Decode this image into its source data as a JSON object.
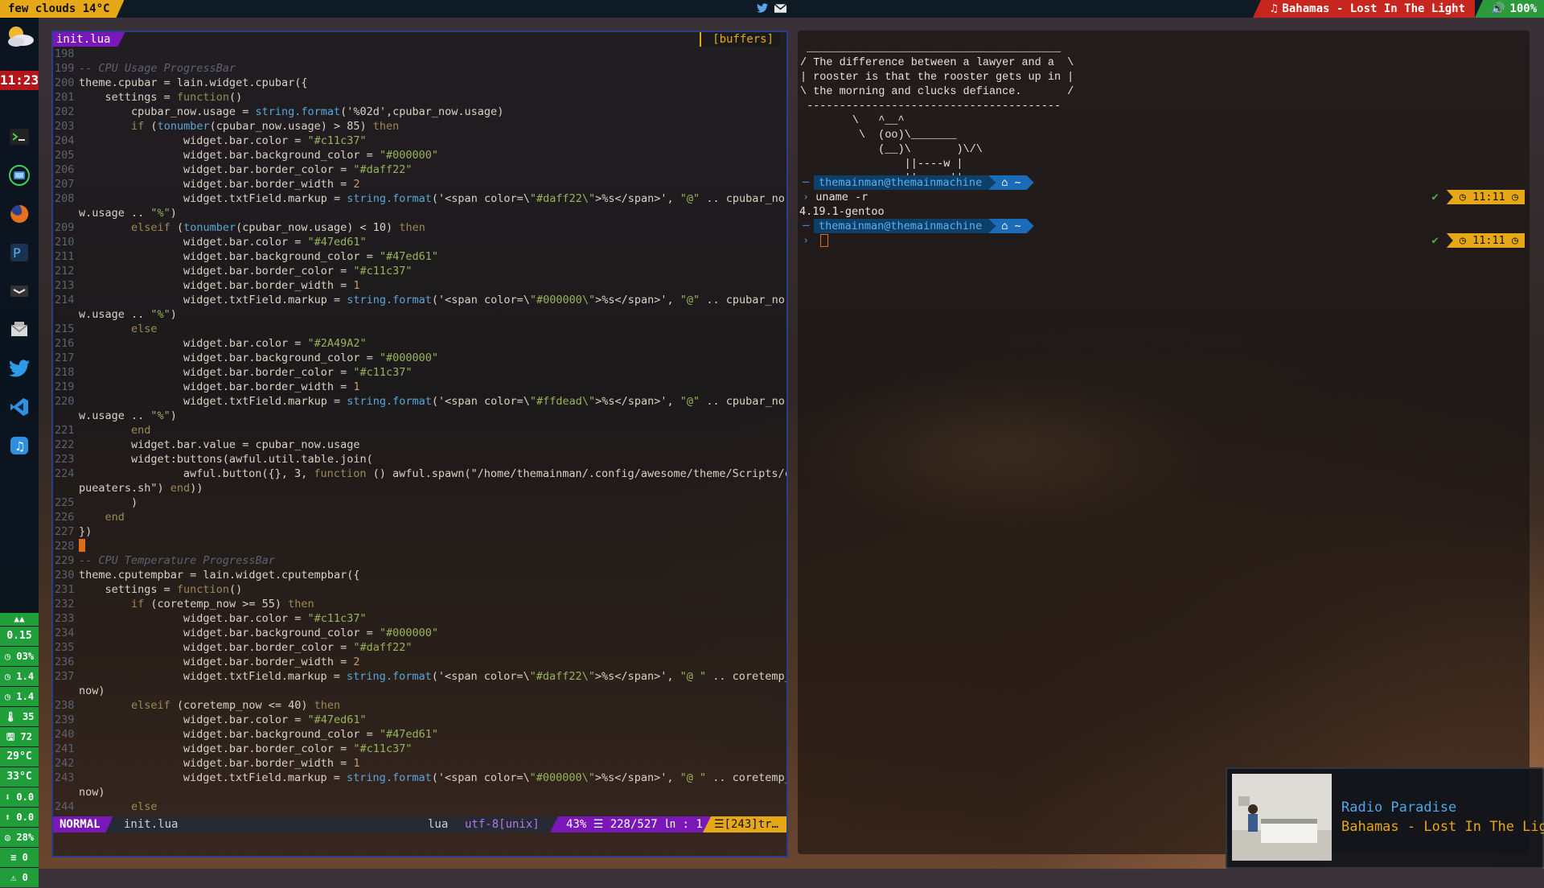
{
  "topbar": {
    "weather": "few clouds 14°C",
    "tray_icons": [
      "twitter-icon",
      "mail-icon"
    ],
    "now_playing": "Bahamas - Lost In The Light",
    "volume": "100%"
  },
  "dock": {
    "clock": "11:23",
    "apps": [
      "terminal-icon",
      "file-manager-icon",
      "firefox-icon",
      "photo-editor-icon",
      "terminal-app-icon",
      "mail-client-icon",
      "twitter-client-icon",
      "vscode-icon",
      "music-player-icon"
    ],
    "stats": [
      "0.15",
      "03%",
      "1.4",
      "1.4",
      "35",
      "72",
      "29°C",
      "33°C",
      "0.0",
      "0.0",
      "28%",
      "0",
      "0"
    ]
  },
  "vim": {
    "tab": "init.lua",
    "buffers_label": "[buffers]",
    "lines": [
      {
        "n": "198",
        "t": ""
      },
      {
        "n": "199",
        "t": "-- CPU Usage ProgressBar"
      },
      {
        "n": "200",
        "t": "theme.cpubar = lain.widget.cpubar({"
      },
      {
        "n": "201",
        "t": "    settings = function()"
      },
      {
        "n": "202",
        "t": "        cpubar_now.usage = string.format('%02d',cpubar_now.usage)"
      },
      {
        "n": "203",
        "t": "        if (tonumber(cpubar_now.usage) > 85) then"
      },
      {
        "n": "204",
        "t": "                widget.bar.color = \"#c11c37\""
      },
      {
        "n": "205",
        "t": "                widget.bar.background_color = \"#000000\""
      },
      {
        "n": "206",
        "t": "                widget.bar.border_color = \"#daff22\""
      },
      {
        "n": "207",
        "t": "                widget.bar.border_width = 2"
      },
      {
        "n": "208",
        "t": "                widget.txtField.markup = string.format('<span color=\\\"#daff22\\\">%s</span>', \"@\" .. cpubar_no"
      },
      {
        "n": "",
        "t": "w.usage .. \"%\")"
      },
      {
        "n": "209",
        "t": "        elseif (tonumber(cpubar_now.usage) < 10) then"
      },
      {
        "n": "210",
        "t": "                widget.bar.color = \"#47ed61\""
      },
      {
        "n": "211",
        "t": "                widget.bar.background_color = \"#47ed61\""
      },
      {
        "n": "212",
        "t": "                widget.bar.border_color = \"#c11c37\""
      },
      {
        "n": "213",
        "t": "                widget.bar.border_width = 1"
      },
      {
        "n": "214",
        "t": "                widget.txtField.markup = string.format('<span color=\\\"#000000\\\">%s</span>', \"@\" .. cpubar_no"
      },
      {
        "n": "",
        "t": "w.usage .. \"%\")"
      },
      {
        "n": "215",
        "t": "        else"
      },
      {
        "n": "216",
        "t": "                widget.bar.color = \"#2A49A2\""
      },
      {
        "n": "217",
        "t": "                widget.bar.background_color = \"#000000\""
      },
      {
        "n": "218",
        "t": "                widget.bar.border_color = \"#c11c37\""
      },
      {
        "n": "219",
        "t": "                widget.bar.border_width = 1"
      },
      {
        "n": "220",
        "t": "                widget.txtField.markup = string.format('<span color=\\\"#ffdead\\\">%s</span>', \"@\" .. cpubar_no"
      },
      {
        "n": "",
        "t": "w.usage .. \"%\")"
      },
      {
        "n": "221",
        "t": "        end"
      },
      {
        "n": "222",
        "t": "        widget.bar.value = cpubar_now.usage"
      },
      {
        "n": "223",
        "t": "        widget:buttons(awful.util.table.join("
      },
      {
        "n": "224",
        "t": "                awful.button({}, 3, function () awful.spawn(\"/home/themainman/.config/awesome/theme/Scripts/c"
      },
      {
        "n": "",
        "t": "pueaters.sh\") end))"
      },
      {
        "n": "225",
        "t": "        )"
      },
      {
        "n": "226",
        "t": "    end"
      },
      {
        "n": "227",
        "t": "})"
      },
      {
        "n": "228",
        "t": ""
      },
      {
        "n": "229",
        "t": "-- CPU Temperature ProgressBar"
      },
      {
        "n": "230",
        "t": "theme.cputempbar = lain.widget.cputempbar({"
      },
      {
        "n": "231",
        "t": "    settings = function()"
      },
      {
        "n": "232",
        "t": "        if (coretemp_now >= 55) then"
      },
      {
        "n": "233",
        "t": "                widget.bar.color = \"#c11c37\""
      },
      {
        "n": "234",
        "t": "                widget.bar.background_color = \"#000000\""
      },
      {
        "n": "235",
        "t": "                widget.bar.border_color = \"#daff22\""
      },
      {
        "n": "236",
        "t": "                widget.bar.border_width = 2"
      },
      {
        "n": "237",
        "t": "                widget.txtField.markup = string.format('<span color=\\\"#daff22\\\">%s</span>', \"@ \" .. coretemp_"
      },
      {
        "n": "",
        "t": "now)"
      },
      {
        "n": "238",
        "t": "        elseif (coretemp_now <= 40) then"
      },
      {
        "n": "239",
        "t": "                widget.bar.color = \"#47ed61\""
      },
      {
        "n": "240",
        "t": "                widget.bar.background_color = \"#47ed61\""
      },
      {
        "n": "241",
        "t": "                widget.bar.border_color = \"#c11c37\""
      },
      {
        "n": "242",
        "t": "                widget.bar.border_width = 1"
      },
      {
        "n": "243",
        "t": "                widget.txtField.markup = string.format('<span color=\\\"#000000\\\">%s</span>', \"@ \" .. coretemp_"
      },
      {
        "n": "",
        "t": "now)"
      },
      {
        "n": "244",
        "t": "        else"
      }
    ],
    "status": {
      "mode": "NORMAL",
      "file": "init.lua",
      "filetype": "lua",
      "encoding": "utf-8[unix]",
      "position": "43% ☰ 228/527 ㏑ :  1",
      "warnings": "☰[243]tr…"
    }
  },
  "terminal": {
    "cowsay": " _______________________________________\n/ The difference between a lawyer and a  \\\n| rooster is that the rooster gets up in |\n\\ the morning and clucks defiance.       /\n ---------------------------------------\n        \\   ^__^\n         \\  (oo)\\_______\n            (__)\\       )\\/\\\n                ||----w |\n                ||     ||",
    "user": "themainman@themainmachine",
    "home": "~",
    "command": "uname -r",
    "output": "4.19.1-gentoo",
    "time": "11:11"
  },
  "notification": {
    "title": "Radio Paradise",
    "body": "Bahamas - Lost In The Light"
  },
  "colors": {
    "accent_purple": "#7a17b8",
    "accent_orange": "#e6a817",
    "accent_red": "#c7261e",
    "accent_green": "#2a9a3c",
    "term_blue": "#1a6bb8"
  }
}
